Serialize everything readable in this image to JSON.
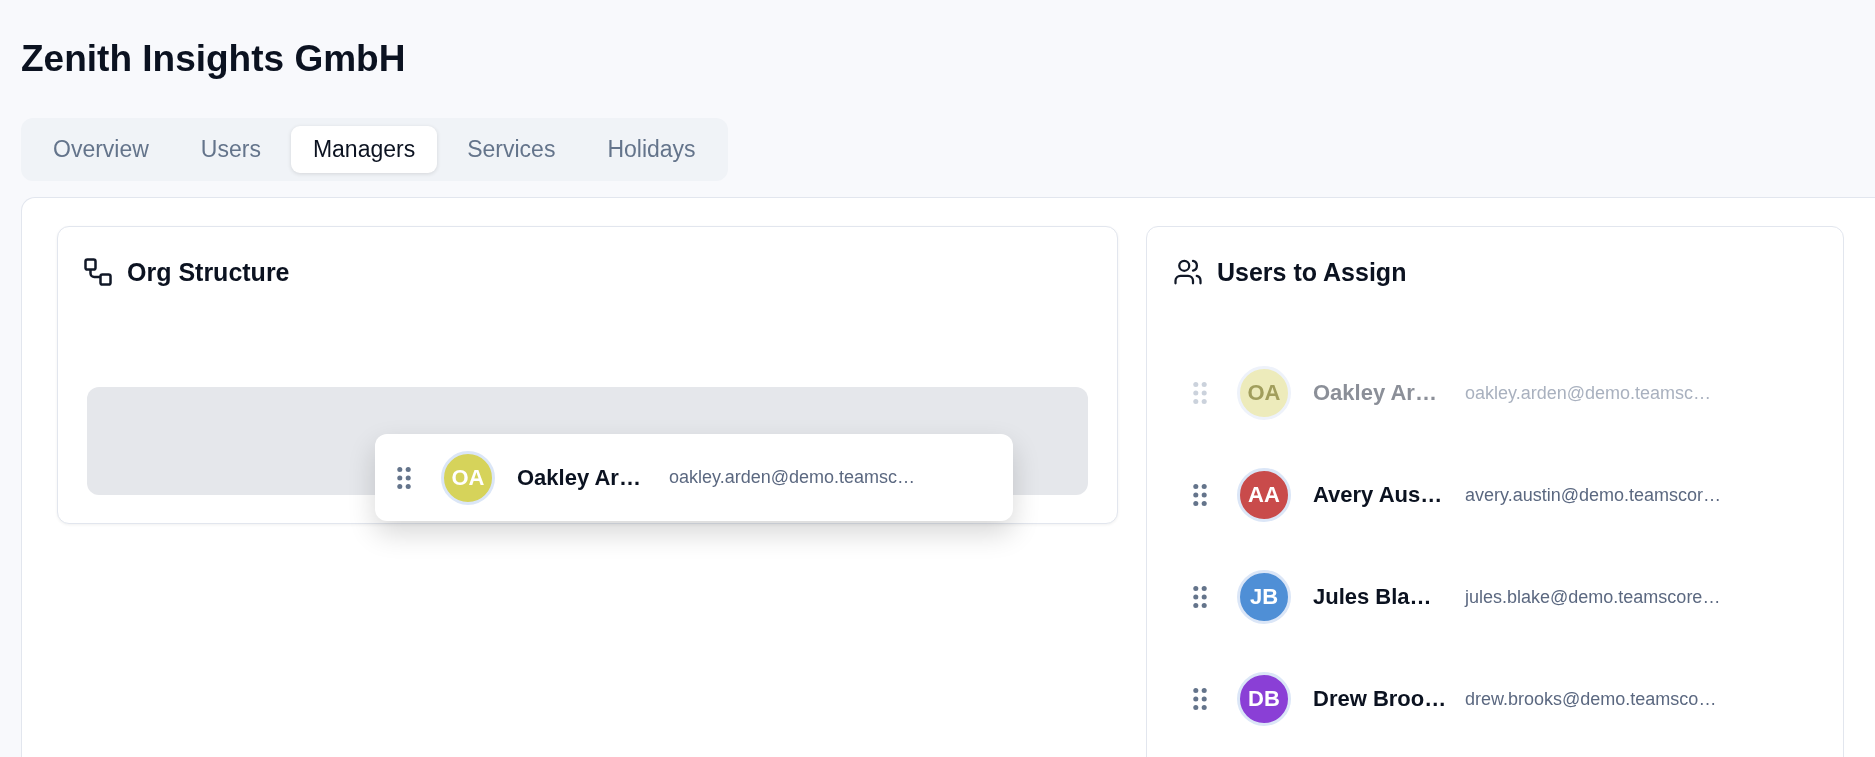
{
  "page": {
    "title": "Zenith Insights GmbH"
  },
  "tabs": [
    {
      "label": "Overview",
      "selected": false
    },
    {
      "label": "Users",
      "selected": false
    },
    {
      "label": "Managers",
      "selected": true
    },
    {
      "label": "Services",
      "selected": false
    },
    {
      "label": "Holidays",
      "selected": false
    }
  ],
  "org_structure": {
    "title": "Org Structure"
  },
  "drag_preview": {
    "initials": "OA",
    "color": "#d6d35a",
    "name": "Oakley Ar…",
    "email": "oakley.arden@demo.teamsc…"
  },
  "users_to_assign": {
    "title": "Users to Assign",
    "users": [
      {
        "initials": "OA",
        "color": "#edebbb",
        "name": "Oakley Ar…",
        "email": "oakley.arden@demo.teamsc…",
        "dragging": true
      },
      {
        "initials": "AA",
        "color": "#c94b4b",
        "name": "Avery Aus…",
        "email": "avery.austin@demo.teamscor…",
        "dragging": false
      },
      {
        "initials": "JB",
        "color": "#4f8fd6",
        "name": "Jules Bla…",
        "email": "jules.blake@demo.teamscore…",
        "dragging": false
      },
      {
        "initials": "DB",
        "color": "#8a3fd6",
        "name": "Drew Broo…",
        "email": "drew.brooks@demo.teamsco…",
        "dragging": false
      }
    ]
  }
}
